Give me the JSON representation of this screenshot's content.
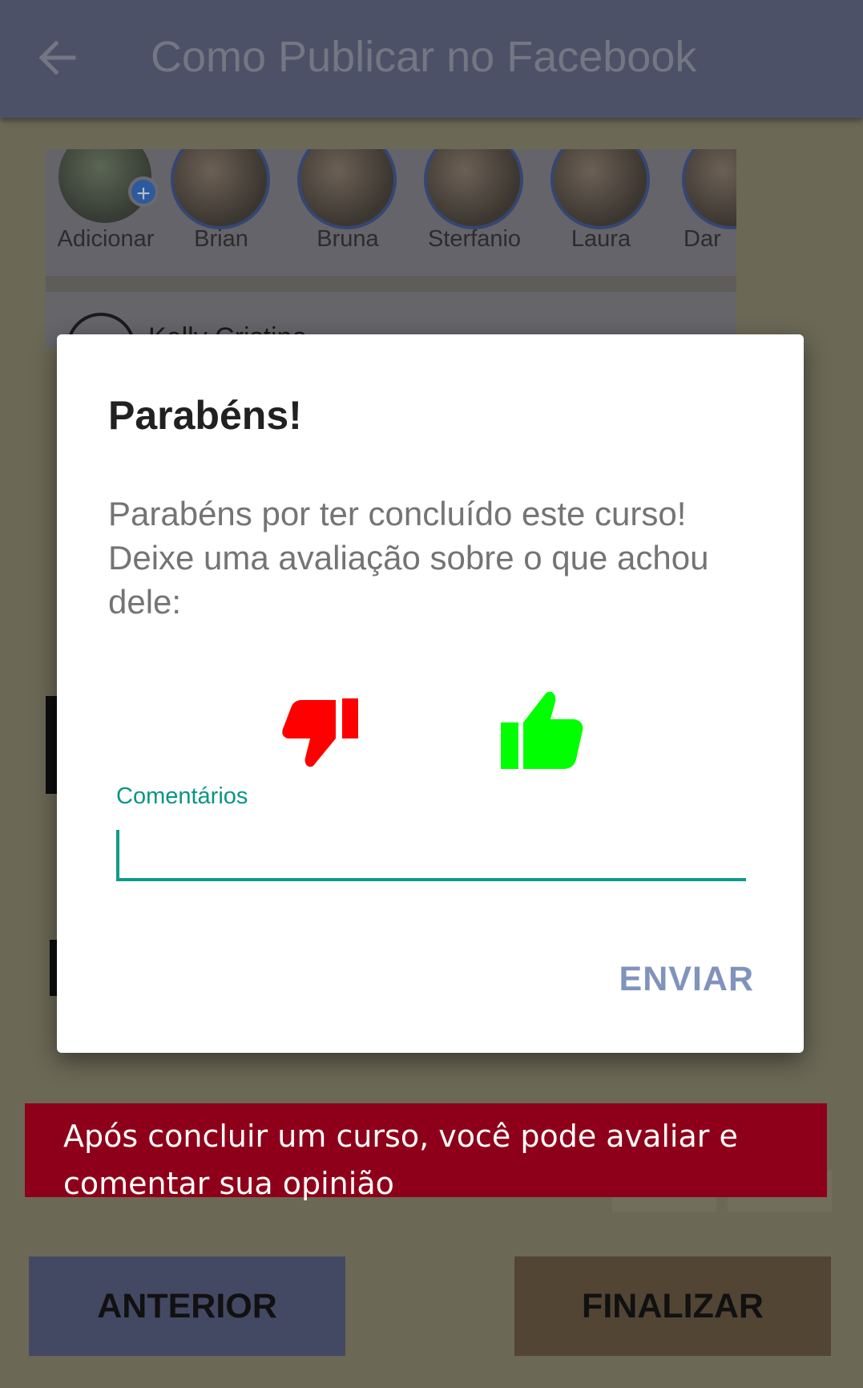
{
  "app_bar": {
    "title": "Como Publicar no Facebook",
    "back_icon": "arrow-left-icon"
  },
  "background": {
    "stories": [
      {
        "name": "Adicionar",
        "self": true
      },
      {
        "name": "Brian"
      },
      {
        "name": "Bruna"
      },
      {
        "name": "Sterfanio"
      },
      {
        "name": "Laura"
      },
      {
        "name": "Dar"
      }
    ],
    "post_author": "Kelly Cristina"
  },
  "dialog": {
    "title": "Parabéns!",
    "message": "Parabéns por ter concluído este curso! Deixe uma avaliação sobre o que achou dele:",
    "dislike_icon": "thumbs-down-icon",
    "like_icon": "thumbs-up-icon",
    "comment_label": "Comentários",
    "comment_value": "",
    "send_label": "ENVIAR"
  },
  "tip": {
    "text": "Após concluir um curso, você pode avaliar e comentar sua opinião"
  },
  "footer": {
    "prev_label": "ANTERIOR",
    "finish_label": "FINALIZAR"
  },
  "colors": {
    "dislike": "#ff0000",
    "like": "#00ff00",
    "accent": "#109a8d",
    "send": "#8093bd",
    "tip_bg": "#8e0019"
  }
}
